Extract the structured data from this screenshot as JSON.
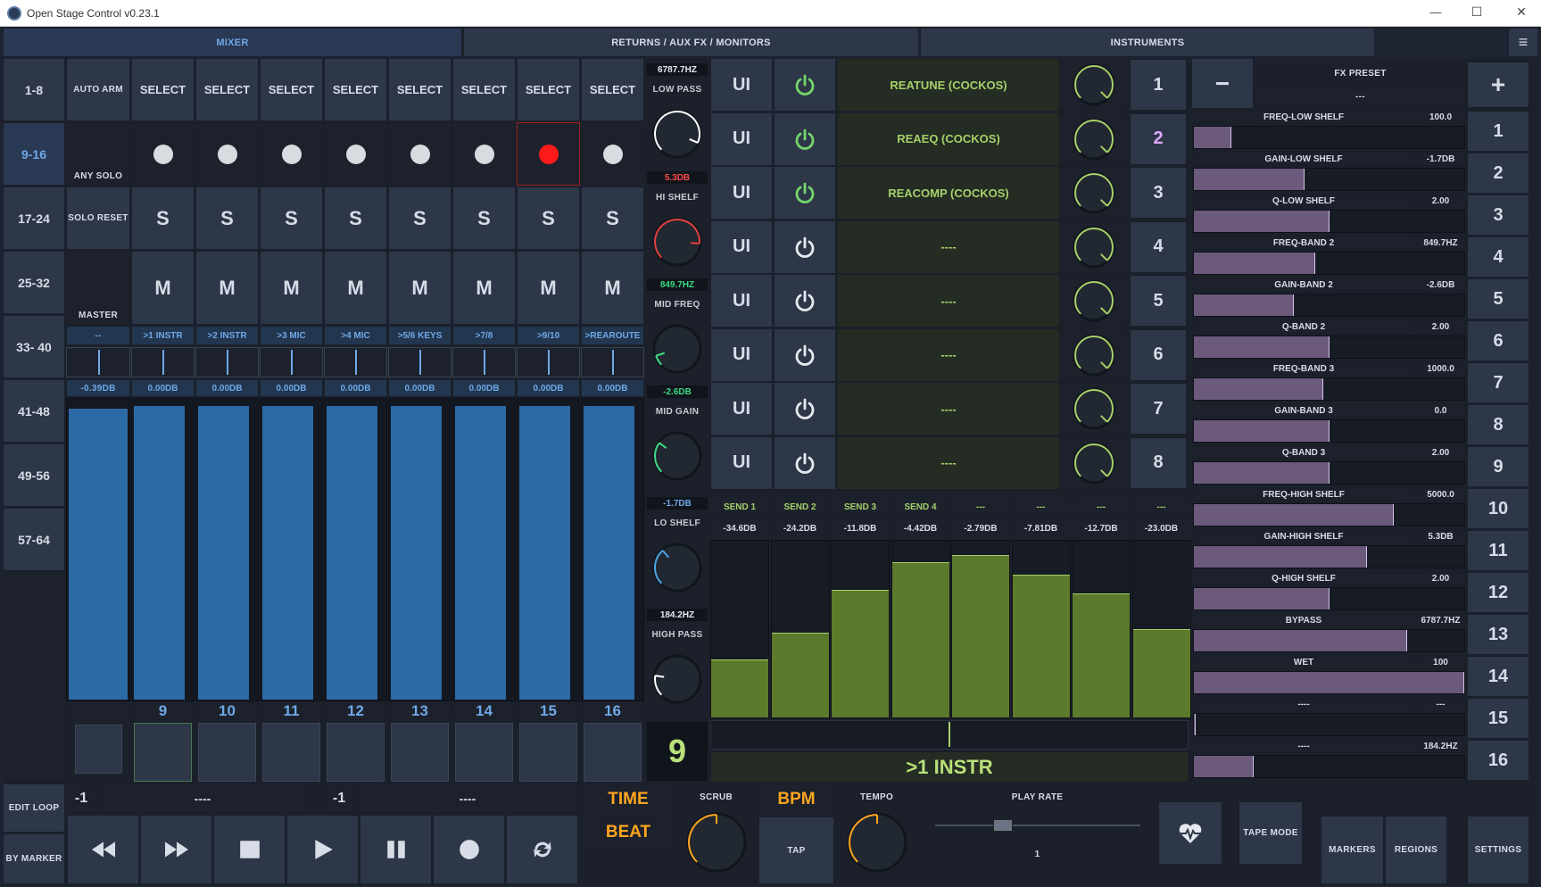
{
  "window": {
    "title": "Open Stage Control v0.23.1",
    "minimize": "—",
    "maximize": "☐",
    "close": "✕"
  },
  "tabs": [
    {
      "label": "MIXER",
      "active": true
    },
    {
      "label": "RETURNS / AUX FX / MONITORS",
      "active": false
    },
    {
      "label": "INSTRUMENTS",
      "active": false
    }
  ],
  "menu_icon": "≡",
  "banks": [
    "1-8",
    "9-16",
    "17-24",
    "25-32",
    "33- 40",
    "41-48",
    "49-56",
    "57-64"
  ],
  "active_bank": 1,
  "left_controls": {
    "auto_arm": "AUTO ARM",
    "any_solo": "ANY SOLO",
    "solo_reset": "SOLO RESET",
    "master": "MASTER",
    "master_route": "--",
    "master_db": "-0.39DB",
    "master_level": 0.97
  },
  "channels": [
    {
      "num": "9",
      "select": "SELECT",
      "solo": "S",
      "mute": "M",
      "route": ">1 INSTR",
      "db": "0.00DB",
      "armed": false,
      "level": 0.98
    },
    {
      "num": "10",
      "select": "SELECT",
      "solo": "S",
      "mute": "M",
      "route": ">2 INSTR",
      "db": "0.00DB",
      "armed": false,
      "level": 0.98
    },
    {
      "num": "11",
      "select": "SELECT",
      "solo": "S",
      "mute": "M",
      "route": ">3 MIC",
      "db": "0.00DB",
      "armed": false,
      "level": 0.98
    },
    {
      "num": "12",
      "select": "SELECT",
      "solo": "S",
      "mute": "M",
      "route": ">4 MIC",
      "db": "0.00DB",
      "armed": false,
      "level": 0.98
    },
    {
      "num": "13",
      "select": "SELECT",
      "solo": "S",
      "mute": "M",
      "route": ">5/6 KEYS",
      "db": "0.00DB",
      "armed": false,
      "level": 0.98
    },
    {
      "num": "14",
      "select": "SELECT",
      "solo": "S",
      "mute": "M",
      "route": ">7/8",
      "db": "0.00DB",
      "armed": false,
      "level": 0.98
    },
    {
      "num": "15",
      "select": "SELECT",
      "solo": "S",
      "mute": "M",
      "route": ">9/10",
      "db": "0.00DB",
      "armed": true,
      "level": 0.98
    },
    {
      "num": "16",
      "select": "SELECT",
      "solo": "S",
      "mute": "M",
      "route": ">REAROUTE",
      "db": "0.00DB",
      "armed": false,
      "level": 0.98
    }
  ],
  "eq": [
    {
      "value": "6787.7HZ",
      "label": "LOW PASS",
      "color": "#ffffff",
      "amount": 0.92
    },
    {
      "value": "5.3DB",
      "label": "HI SHELF",
      "color": "#e04040",
      "amount": 0.85
    },
    {
      "value": "849.7HZ",
      "label": "MID FREQ",
      "color": "#3ddc84",
      "amount": 0.1
    },
    {
      "value": "-2.6DB",
      "label": "MID GAIN",
      "color": "#3ddc84",
      "amount": 0.3
    },
    {
      "value": "-1.7DB",
      "label": "LO SHELF",
      "color": "#4aa8e8",
      "amount": 0.35
    },
    {
      "value": "184.2HZ",
      "label": "HIGH PASS",
      "color": "#ffffff",
      "amount": 0.2
    }
  ],
  "selected_channel": "9",
  "selected_name": ">1 INSTR",
  "fx_slots": [
    {
      "ui": "UI",
      "name": "REATUNE (COCKOS)",
      "on": true,
      "wet": 1.0,
      "num": "1"
    },
    {
      "ui": "UI",
      "name": "REAEQ (COCKOS)",
      "on": true,
      "wet": 1.0,
      "num": "2"
    },
    {
      "ui": "UI",
      "name": "REACOMP (COCKOS)",
      "on": true,
      "wet": 1.0,
      "num": "3"
    },
    {
      "ui": "UI",
      "name": "----",
      "on": false,
      "wet": 1.0,
      "num": "4"
    },
    {
      "ui": "UI",
      "name": "----",
      "on": false,
      "wet": 1.0,
      "num": "5"
    },
    {
      "ui": "UI",
      "name": "----",
      "on": false,
      "wet": 1.0,
      "num": "6"
    },
    {
      "ui": "UI",
      "name": "----",
      "on": false,
      "wet": 1.0,
      "num": "7"
    },
    {
      "ui": "UI",
      "name": "----",
      "on": false,
      "wet": 1.0,
      "num": "8"
    }
  ],
  "active_fx_slot": 1,
  "sends": [
    {
      "name": "SEND 1",
      "db": "-34.6DB",
      "level": 0.33
    },
    {
      "name": "SEND 2",
      "db": "-24.2DB",
      "level": 0.48
    },
    {
      "name": "SEND 3",
      "db": "-11.8DB",
      "level": 0.72
    },
    {
      "name": "SEND 4",
      "db": "-4.42DB",
      "level": 0.88
    },
    {
      "name": "---",
      "db": "-2.79DB",
      "level": 0.92
    },
    {
      "name": "---",
      "db": "-7.81DB",
      "level": 0.81
    },
    {
      "name": "---",
      "db": "-12.7DB",
      "level": 0.7
    },
    {
      "name": "---",
      "db": "-23.0DB",
      "level": 0.5
    }
  ],
  "fx_preset": {
    "title": "FX PRESET",
    "value": "---",
    "minus": "−",
    "plus": "+"
  },
  "params": [
    {
      "name": "FREQ-LOW SHELF",
      "value": "100.0",
      "level": 0.14
    },
    {
      "name": "GAIN-LOW SHELF",
      "value": "-1.7DB",
      "level": 0.41
    },
    {
      "name": "Q-LOW SHELF",
      "value": "2.00",
      "level": 0.5
    },
    {
      "name": "FREQ-BAND 2",
      "value": "849.7HZ",
      "level": 0.45
    },
    {
      "name": "GAIN-BAND 2",
      "value": "-2.6DB",
      "level": 0.37
    },
    {
      "name": "Q-BAND 2",
      "value": "2.00",
      "level": 0.5
    },
    {
      "name": "FREQ-BAND 3",
      "value": "1000.0",
      "level": 0.48
    },
    {
      "name": "GAIN-BAND 3",
      "value": "0.0",
      "level": 0.5
    },
    {
      "name": "Q-BAND 3",
      "value": "2.00",
      "level": 0.5
    },
    {
      "name": "FREQ-HIGH SHELF",
      "value": "5000.0",
      "level": 0.74
    },
    {
      "name": "GAIN-HIGH SHELF",
      "value": "5.3DB",
      "level": 0.64
    },
    {
      "name": "Q-HIGH SHELF",
      "value": "2.00",
      "level": 0.5
    },
    {
      "name": "BYPASS",
      "value": "6787.7HZ",
      "level": 0.79
    },
    {
      "name": "WET",
      "value": "100",
      "level": 1.0
    },
    {
      "name": "----",
      "value": "---",
      "level": 0.0
    },
    {
      "name": "----",
      "value": "184.2HZ",
      "level": 0.22
    }
  ],
  "param_nums": [
    "1",
    "2",
    "3",
    "4",
    "5",
    "6",
    "7",
    "8",
    "9",
    "10",
    "11",
    "12",
    "13",
    "14",
    "15",
    "16"
  ],
  "transport": {
    "edit_loop": "EDIT LOOP",
    "by_marker": "BY MARKER",
    "loop_start_num": "-1",
    "loop_start": "----",
    "loop_end_num": "-1",
    "loop_end": "----",
    "time": "TIME",
    "beat": "BEAT",
    "scrub": "SCRUB",
    "bpm": "BPM",
    "tap": "TAP",
    "tempo": "TEMPO",
    "play_rate": "PLAY RATE",
    "play_rate_value": "1",
    "tape_mode": "TAPE MODE",
    "markers": "MARKERS",
    "regions": "REGIONS",
    "settings": "SETTINGS"
  }
}
